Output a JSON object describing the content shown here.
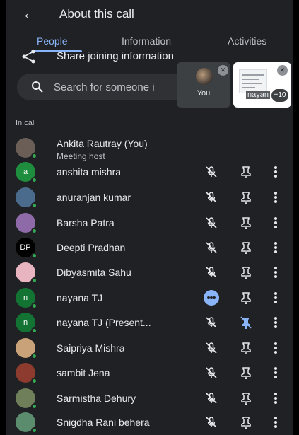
{
  "header": {
    "back_icon": "arrow-left-icon",
    "title": "About this call"
  },
  "tabs": [
    "People",
    "Information",
    "Activities"
  ],
  "share": {
    "icon": "share-icon",
    "label": "Share joining information"
  },
  "search": {
    "placeholder": "Search for someone i"
  },
  "tiles": {
    "you_label": "You",
    "share_name": "nayan",
    "more_count": "+10"
  },
  "section_label": "In call",
  "participants": [
    {
      "name": "Ankita Rautray (You)",
      "subtitle": "Meeting host",
      "avatar_text": "",
      "avatar_color": "#6b5e57",
      "mute": false,
      "pin": false,
      "more": false
    },
    {
      "name": "anshita mishra",
      "avatar_text": "a",
      "avatar_color": "#1e8e3e",
      "mute": "muted",
      "pin": "normal",
      "more": true
    },
    {
      "name": "anuranjan kumar",
      "avatar_text": "",
      "avatar_color": "#4a6b8c",
      "mute": "muted",
      "pin": "normal",
      "more": true
    },
    {
      "name": "Barsha Patra",
      "avatar_text": "",
      "avatar_color": "#8e6aa8",
      "mute": "muted",
      "pin": "normal",
      "more": true
    },
    {
      "name": "Deepti Pradhan",
      "avatar_text": "DP",
      "avatar_color": "#000000",
      "mute": "muted",
      "pin": "normal",
      "more": true
    },
    {
      "name": "Dibyasmita Sahu",
      "avatar_text": "",
      "avatar_color": "#e8b4c0",
      "mute": "muted",
      "pin": "normal",
      "more": true
    },
    {
      "name": "nayana TJ",
      "avatar_text": "n",
      "avatar_color": "#137333",
      "mute": "speaking",
      "pin": "normal",
      "more": true
    },
    {
      "name": "nayana TJ (Present...",
      "avatar_text": "n",
      "avatar_color": "#137333",
      "mute": "muted",
      "pin": "pinned",
      "more": true
    },
    {
      "name": "Saipriya Mishra",
      "avatar_text": "",
      "avatar_color": "#c9a27a",
      "mute": "muted",
      "pin": "normal",
      "more": true
    },
    {
      "name": "sambit Jena",
      "avatar_text": "",
      "avatar_color": "#8c3b2e",
      "mute": "muted",
      "pin": "normal",
      "more": true
    },
    {
      "name": "Sarmistha Dehury",
      "avatar_text": "",
      "avatar_color": "#6e7f5a",
      "mute": "muted",
      "pin": "normal",
      "more": true
    },
    {
      "name": "Snigdha Rani behera",
      "avatar_text": "",
      "avatar_color": "#5b8c6e",
      "mute": "muted",
      "pin": "normal",
      "more": true
    }
  ],
  "colors": {
    "background": "#202124",
    "accent": "#8ab4f8",
    "online": "#34a853"
  }
}
